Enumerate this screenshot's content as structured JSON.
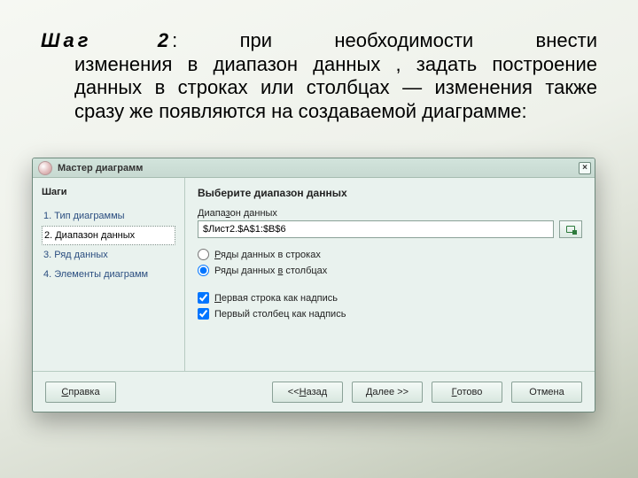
{
  "instruction": {
    "lead": "Шаг 2",
    "sep": ": ",
    "body_first": "при необходимости внести",
    "body_rest": "изменения в диапазон данных , задать построение данных в строках или столбцах — изменения также сразу же появляются на создаваемой диаграмме:"
  },
  "dialog": {
    "title": "Мастер диаграмм",
    "close_glyph": "×",
    "sidebar": {
      "heading": "Шаги",
      "items": [
        {
          "label": "1. Тип диаграммы"
        },
        {
          "label": "2. Диапазон данных",
          "active": true
        },
        {
          "label": "3. Ряд данных"
        },
        {
          "label": "4. Элементы диаграмм"
        }
      ]
    },
    "main": {
      "heading": "Выберите диапазон данных",
      "range_label": "Диапазон данных",
      "range_value": "$Лист2.$A$1:$B$6",
      "opt_rows": "Ряды данных в строках",
      "opt_cols": "Ряды данных в столбцах",
      "chk_first_row": "Первая строка как надпись",
      "chk_first_col": "Первый столбец как надпись",
      "selected_orientation": "cols",
      "first_row_checked": true,
      "first_col_checked": true
    },
    "buttons": {
      "help": "Справка",
      "back": "<<Назад",
      "next": "Далее >>",
      "finish": "Готово",
      "cancel": "Отмена"
    }
  }
}
